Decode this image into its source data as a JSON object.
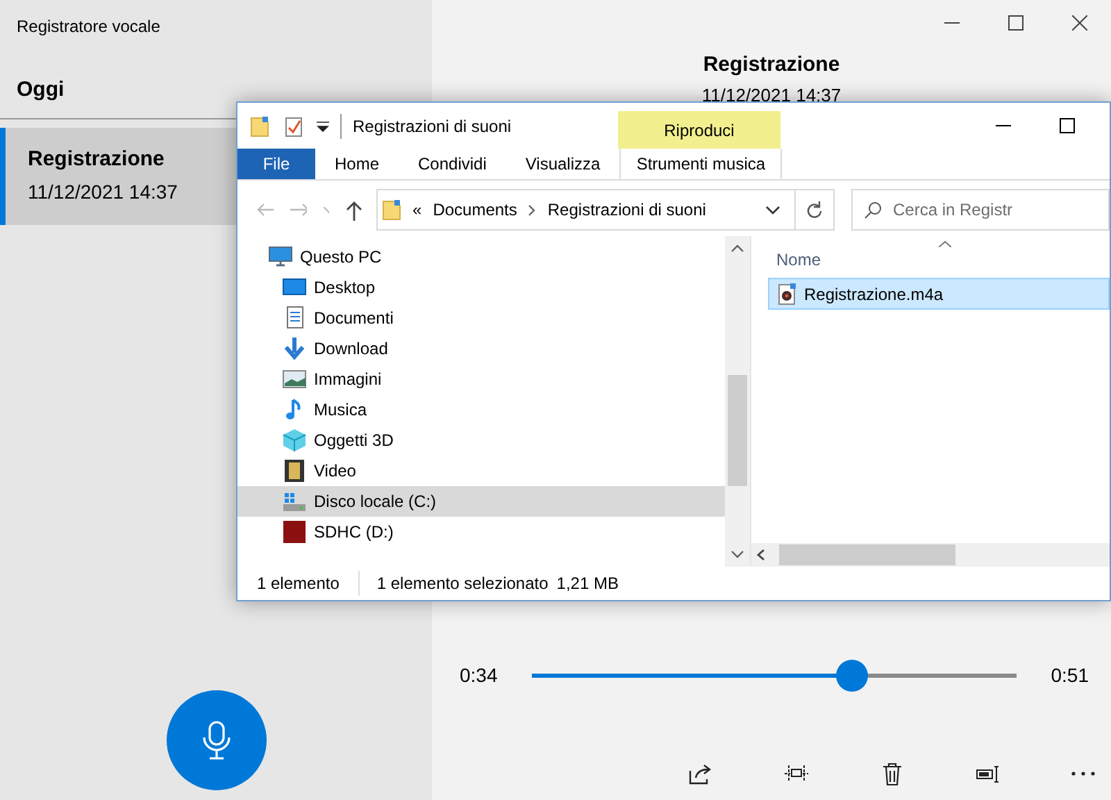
{
  "recorder": {
    "title": "Registratore vocale"
  },
  "list": {
    "heading": "Oggi",
    "items": [
      {
        "name": "Registrazione",
        "date": "11/12/2021 14:37",
        "selected": true
      }
    ]
  },
  "detail": {
    "title": "Registrazione",
    "date": "11/12/2021 14:37"
  },
  "player": {
    "elapsed": "0:34",
    "total": "0:51",
    "level": 0.66
  },
  "explorer": {
    "title": "Registrazioni di suoni",
    "context_tab": "Riproduci",
    "ribbon_tabs": [
      {
        "label": "File",
        "kind": "file"
      },
      {
        "label": "Home",
        "kind": "tab"
      },
      {
        "label": "Condividi",
        "kind": "tab"
      },
      {
        "label": "Visualizza",
        "kind": "tab"
      },
      {
        "label": "Strumenti musica",
        "kind": "context"
      }
    ],
    "path_prefix": "«",
    "path": [
      "Documents",
      "Registrazioni di suoni"
    ],
    "search": {
      "placeholder": "Cerca in Registr"
    },
    "tree": [
      {
        "label": "Questo PC",
        "kind": "pc",
        "selected": false,
        "children": [
          {
            "label": "Desktop",
            "kind": "desktop",
            "selected": false
          },
          {
            "label": "Documenti",
            "kind": "documents",
            "selected": false
          },
          {
            "label": "Download",
            "kind": "download",
            "selected": false
          },
          {
            "label": "Immagini",
            "kind": "pictures",
            "selected": false
          },
          {
            "label": "Musica",
            "kind": "music",
            "selected": false
          },
          {
            "label": "Oggetti 3D",
            "kind": "objects",
            "selected": false
          },
          {
            "label": "Video",
            "kind": "video",
            "selected": false
          },
          {
            "label": "Disco locale (C:)",
            "kind": "drive",
            "selected": true
          },
          {
            "label": "SDHC (D:)",
            "kind": "sd",
            "selected": false
          }
        ]
      }
    ],
    "column": "Nome",
    "files": [
      {
        "name": "Registrazione.m4a",
        "selected": true
      }
    ],
    "status": {
      "count": "1 elemento",
      "selection": "1 elemento selezionato",
      "size": "1,21 MB"
    }
  }
}
